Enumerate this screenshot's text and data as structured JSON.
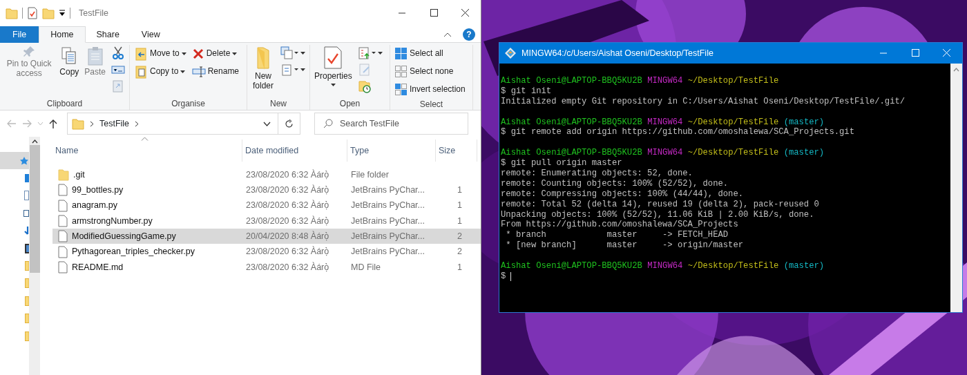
{
  "explorer": {
    "title": "TestFile",
    "ribbon_tabs": [
      {
        "label": "File",
        "kind": "file",
        "selected": false
      },
      {
        "label": "Home",
        "kind": "tab",
        "selected": true
      },
      {
        "label": "Share",
        "kind": "tab",
        "selected": false
      },
      {
        "label": "View",
        "kind": "tab",
        "selected": false
      }
    ],
    "help_button": "?",
    "ribbon_groups": [
      {
        "label": "Clipboard",
        "columns": [
          [
            {
              "kind": "large",
              "label": "Pin to Quick access",
              "disabled": true,
              "dropdown": false
            }
          ],
          [
            {
              "kind": "large",
              "label": "Copy",
              "disabled": false,
              "dropdown": false
            }
          ],
          [
            {
              "kind": "large",
              "label": "Paste",
              "disabled": true,
              "dropdown": false
            }
          ],
          [
            {
              "kind": "icon",
              "disabled": false,
              "dropdown": false
            },
            {
              "kind": "icon",
              "disabled": false,
              "dropdown": false
            },
            {
              "kind": "icon",
              "disabled": true,
              "dropdown": false
            }
          ]
        ]
      },
      {
        "label": "Organise",
        "columns": [
          [
            {
              "kind": "small",
              "label": "Move to",
              "disabled": false,
              "dropdown": true
            },
            {
              "kind": "small",
              "label": "Copy to",
              "disabled": false,
              "dropdown": true
            }
          ],
          [
            {
              "kind": "small",
              "label": "Delete",
              "disabled": false,
              "dropdown": true
            },
            {
              "kind": "small",
              "label": "Rename",
              "disabled": false,
              "dropdown": false
            }
          ]
        ]
      },
      {
        "label": "New",
        "columns": [
          [
            {
              "kind": "large",
              "label": "New folder",
              "disabled": false,
              "dropdown": false
            }
          ],
          [
            {
              "kind": "icon",
              "disabled": false,
              "dropdown": true
            },
            {
              "kind": "icon",
              "disabled": false,
              "dropdown": true
            }
          ]
        ]
      },
      {
        "label": "Open",
        "columns": [
          [
            {
              "kind": "large",
              "label": "Properties",
              "disabled": false,
              "dropdown": true
            }
          ],
          [
            {
              "kind": "icon",
              "disabled": false,
              "dropdown": true
            },
            {
              "kind": "icon",
              "disabled": true,
              "dropdown": false
            },
            {
              "kind": "icon",
              "disabled": false,
              "dropdown": false
            }
          ]
        ]
      },
      {
        "label": "Select",
        "columns": [
          [
            {
              "kind": "small",
              "label": "Select all",
              "disabled": false,
              "dropdown": false
            },
            {
              "kind": "small",
              "label": "Select none",
              "disabled": false,
              "dropdown": false
            },
            {
              "kind": "small",
              "label": "Invert selection",
              "disabled": false,
              "dropdown": false
            }
          ]
        ]
      }
    ],
    "address": {
      "path": "TestFile"
    },
    "search": {
      "placeholder": "Search TestFile"
    },
    "navigation_pane": [
      {
        "selected": true
      },
      {
        "selected": false
      },
      {
        "selected": false
      },
      {
        "selected": false
      },
      {
        "selected": false
      },
      {
        "selected": false
      },
      {
        "selected": false
      },
      {
        "selected": false
      },
      {
        "selected": false
      },
      {
        "selected": false
      },
      {
        "selected": false
      }
    ],
    "columns": [
      "Name",
      "Date modified",
      "Type",
      "Size"
    ],
    "files": [
      {
        "kind": "folder",
        "name": ".git",
        "date": "23/08/2020 6:32 Àárọ̀",
        "type": "File folder",
        "selected": false
      },
      {
        "kind": "file",
        "name": "99_bottles.py",
        "date": "23/08/2020 6:32 Àárọ̀",
        "type": "JetBrains PyChar...",
        "size": "1",
        "selected": false
      },
      {
        "kind": "file",
        "name": "anagram.py",
        "date": "23/08/2020 6:32 Àárọ̀",
        "type": "JetBrains PyChar...",
        "size": "1",
        "selected": false
      },
      {
        "kind": "file",
        "name": "armstrongNumber.py",
        "date": "23/08/2020 6:32 Àárọ̀",
        "type": "JetBrains PyChar...",
        "size": "1",
        "selected": false
      },
      {
        "kind": "file",
        "name": "ModifiedGuessingGame.py",
        "date": "20/04/2020 8:48 Àárọ̀",
        "type": "JetBrains PyChar...",
        "size": "2",
        "selected": true
      },
      {
        "kind": "file",
        "name": "Pythagorean_triples_checker.py",
        "date": "23/08/2020 6:32 Àárọ̀",
        "type": "JetBrains PyChar...",
        "size": "2",
        "selected": false
      },
      {
        "kind": "file",
        "name": "README.md",
        "date": "23/08/2020 6:32 Àárọ̀",
        "type": "MD File",
        "size": "1",
        "selected": false
      }
    ]
  },
  "terminal": {
    "title": "MINGW64:/c/Users/Aishat Oseni/Desktop/TestFile",
    "lines": [
      {
        "kind": "prompt",
        "segments": [
          {
            "text": "Aishat Oseni@LAPTOP-BBQ5KU2B",
            "color": "#1fc31f"
          },
          {
            "text": "MINGW64",
            "color": "#c429c4"
          },
          {
            "text": "~/Desktop/TestFile",
            "color": "#c4bf1a"
          }
        ]
      },
      {
        "kind": "text",
        "text": "$ git init"
      },
      {
        "kind": "text",
        "text": "Initialized empty Git repository in C:/Users/Aishat Oseni/Desktop/TestFile/.git/"
      },
      {
        "kind": "blank"
      },
      {
        "kind": "prompt",
        "segments": [
          {
            "text": "Aishat Oseni@LAPTOP-BBQ5KU2B",
            "color": "#1fc31f"
          },
          {
            "text": "MINGW64",
            "color": "#c429c4"
          },
          {
            "text": "~/Desktop/TestFile",
            "color": "#c4bf1a"
          },
          {
            "text": "(master)",
            "color": "#14b8c4"
          }
        ]
      },
      {
        "kind": "text",
        "text": "$ git remote add origin https://github.com/omoshalewa/SCA_Projects.git"
      },
      {
        "kind": "blank"
      },
      {
        "kind": "prompt",
        "segments": [
          {
            "text": "Aishat Oseni@LAPTOP-BBQ5KU2B",
            "color": "#1fc31f"
          },
          {
            "text": "MINGW64",
            "color": "#c429c4"
          },
          {
            "text": "~/Desktop/TestFile",
            "color": "#c4bf1a"
          },
          {
            "text": "(master)",
            "color": "#14b8c4"
          }
        ]
      },
      {
        "kind": "text",
        "text": "$ git pull origin master"
      },
      {
        "kind": "text",
        "text": "remote: Enumerating objects: 52, done."
      },
      {
        "kind": "text",
        "text": "remote: Counting objects: 100% (52/52), done."
      },
      {
        "kind": "text",
        "text": "remote: Compressing objects: 100% (44/44), done."
      },
      {
        "kind": "text",
        "text": "remote: Total 52 (delta 14), reused 19 (delta 2), pack-reused 0"
      },
      {
        "kind": "text",
        "text": "Unpacking objects: 100% (52/52), 11.06 KiB | 2.00 KiB/s, done."
      },
      {
        "kind": "text",
        "text": "From https://github.com/omoshalewa/SCA_Projects"
      },
      {
        "kind": "text",
        "text": " * branch            master     -> FETCH_HEAD"
      },
      {
        "kind": "text",
        "text": " * [new branch]      master     -> origin/master"
      },
      {
        "kind": "blank"
      },
      {
        "kind": "prompt",
        "segments": [
          {
            "text": "Aishat Oseni@LAPTOP-BBQ5KU2B",
            "color": "#1fc31f"
          },
          {
            "text": "MINGW64",
            "color": "#c429c4"
          },
          {
            "text": "~/Desktop/TestFile",
            "color": "#c4bf1a"
          },
          {
            "text": "(master)",
            "color": "#14b8c4"
          }
        ]
      },
      {
        "kind": "cursor",
        "text": "$"
      }
    ]
  }
}
